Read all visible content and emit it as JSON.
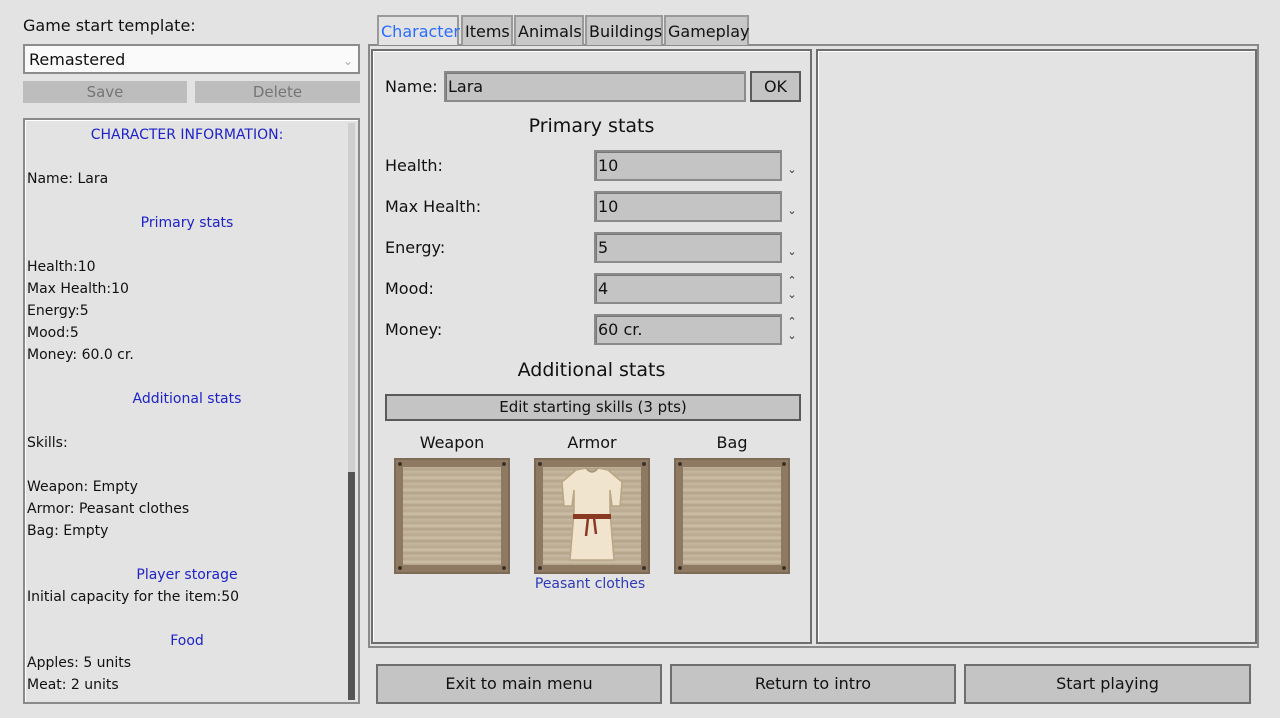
{
  "template": {
    "label": "Game start template:",
    "selected": "Remastered",
    "save_label": "Save",
    "delete_label": "Delete"
  },
  "info": {
    "title": "CHARACTER INFORMATION:",
    "name_line": "Name: Lara",
    "primary_header": "Primary stats",
    "health_line": "Health:10",
    "max_health_line": "Max Health:10",
    "energy_line": "Energy:5",
    "mood_line": "Mood:5",
    "money_line": "Money: 60.0 cr.",
    "additional_header": "Additional stats",
    "skills_line": "Skills:",
    "weapon_line": "Weapon: Empty",
    "armor_line": "Armor: Peasant clothes",
    "bag_line": "Bag: Empty",
    "storage_header": "Player storage",
    "storage_line": "Initial capacity for the item:50",
    "food_header": "Food",
    "apples_line": "Apples: 5 units",
    "meat_line": "Meat: 2 units"
  },
  "tabs": [
    "Character",
    "Items",
    "Animals",
    "Buildings",
    "Gameplay"
  ],
  "active_tab": "Character",
  "character": {
    "name_label": "Name:",
    "name_value": "Lara",
    "ok_label": "OK",
    "primary_title": "Primary stats",
    "stats": [
      {
        "label": "Health:",
        "value": "10"
      },
      {
        "label": "Max Health:",
        "value": "10"
      },
      {
        "label": "Energy:",
        "value": "5"
      },
      {
        "label": "Mood:",
        "value": "4"
      },
      {
        "label": "Money:",
        "value": "60 cr."
      }
    ],
    "additional_title": "Additional stats",
    "skills_button": "Edit starting skills (3 pts)",
    "slots": {
      "weapon": "Weapon",
      "armor": "Armor",
      "bag": "Bag"
    },
    "armor_item": "Peasant clothes"
  },
  "bottom": {
    "exit_label": "Exit to main menu",
    "intro_label": "Return to intro",
    "start_label": "Start playing"
  },
  "colors": {
    "active_tab": "#2a6cff",
    "info_header": "#1e22c8",
    "item_link": "#2e3ab8",
    "panel_bg": "#e3e3e3",
    "field_bg": "#c4c4c4"
  }
}
